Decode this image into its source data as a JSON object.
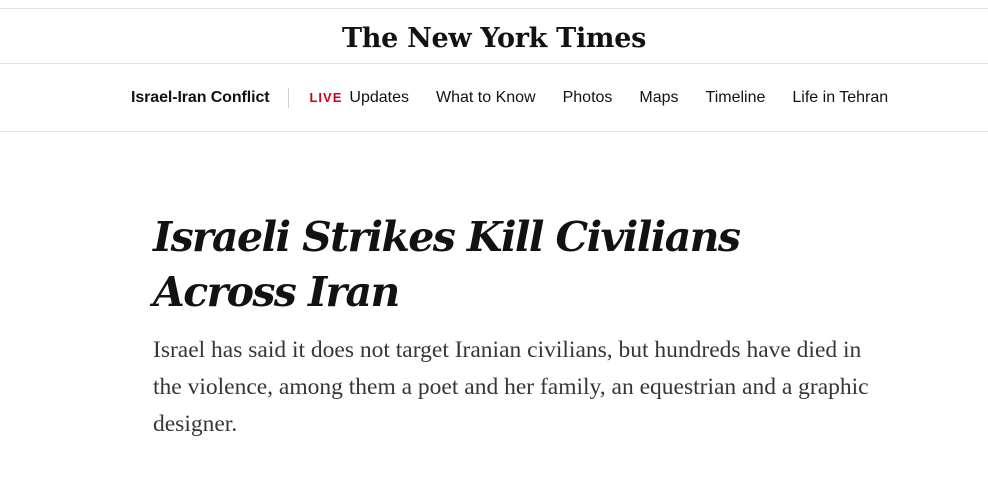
{
  "masthead": {
    "logo_text": "The New York Times"
  },
  "subnav": {
    "section_title": "Israel-Iran Conflict",
    "live_tag": "LIVE",
    "links": [
      "Updates",
      "What to Know",
      "Photos",
      "Maps",
      "Timeline",
      "Life in Tehran"
    ]
  },
  "article": {
    "headline": "Israeli Strikes Kill Civilians Across Iran",
    "summary": "Israel has said it does not target Iranian civilians, but hundreds have died in the violence, among them a poet and her family, an equestrian and a graphic designer."
  },
  "colors": {
    "live_red": "#d0021b",
    "text": "#121212",
    "summary_text": "#363636",
    "rule": "#dfdfdf"
  }
}
